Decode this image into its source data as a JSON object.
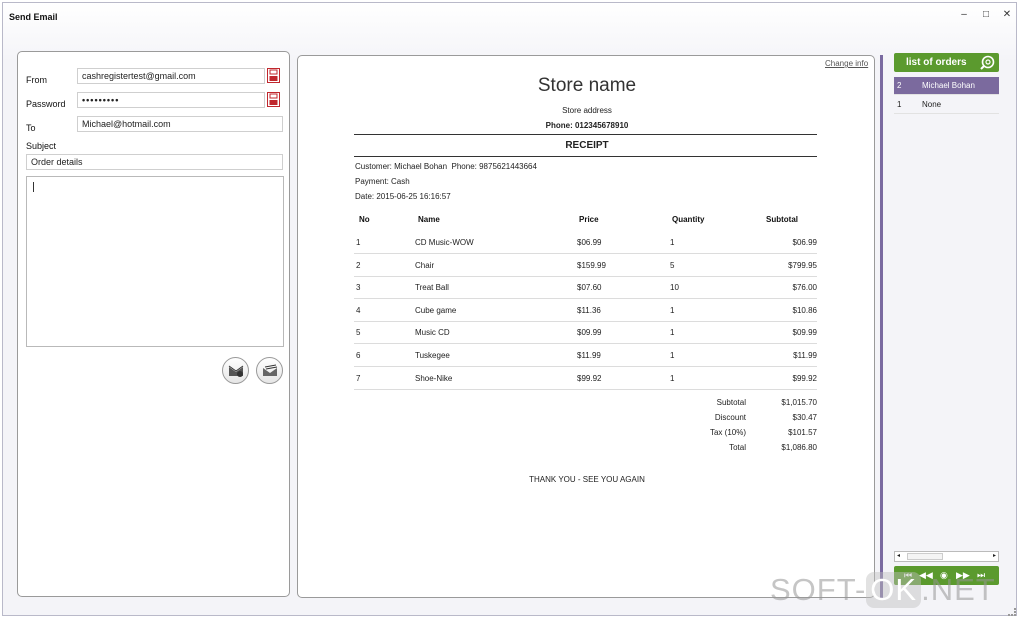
{
  "window": {
    "title": "Send Email",
    "minimize": "–",
    "maximize": "□",
    "close": "✕"
  },
  "email_form": {
    "from_label": "From",
    "from_value": "cashregistertest@gmail.com",
    "password_label": "Password",
    "password_value": "•••••••••",
    "to_label": "To",
    "to_value": "Michael@hotmail.com",
    "subject_label": "Subject",
    "subject_value": "Order details",
    "body_value": ""
  },
  "receipt": {
    "change_info": "Change info",
    "store_name": "Store name",
    "store_address": "Store address",
    "phone": "Phone: 012345678910",
    "title": "RECEIPT",
    "customer_label": "Customer:",
    "customer_value": "Michael Bohan",
    "customer_phone_label": "Phone:",
    "customer_phone_value": "9875621443664",
    "payment_label": "Payment:",
    "payment_value": "Cash",
    "date_label": "Date:",
    "date_value": "2015-06-25 16:16:57",
    "columns": [
      "No",
      "Name",
      "Price",
      "Quantity",
      "Subtotal"
    ],
    "items": [
      {
        "no": "1",
        "name": "CD Music-WOW",
        "price": "$06.99",
        "qty": "1",
        "subtotal": "$06.99"
      },
      {
        "no": "2",
        "name": "Chair",
        "price": "$159.99",
        "qty": "5",
        "subtotal": "$799.95"
      },
      {
        "no": "3",
        "name": "Treat Ball",
        "price": "$07.60",
        "qty": "10",
        "subtotal": "$76.00"
      },
      {
        "no": "4",
        "name": "Cube game",
        "price": "$11.36",
        "qty": "1",
        "subtotal": "$10.86"
      },
      {
        "no": "5",
        "name": "Music CD",
        "price": "$09.99",
        "qty": "1",
        "subtotal": "$09.99"
      },
      {
        "no": "6",
        "name": "Tuskegee",
        "price": "$11.99",
        "qty": "1",
        "subtotal": "$11.99"
      },
      {
        "no": "7",
        "name": "Shoe-Nike",
        "price": "$99.92",
        "qty": "1",
        "subtotal": "$99.92"
      }
    ],
    "totals": [
      {
        "label": "Subtotal",
        "value": "$1,015.70"
      },
      {
        "label": "Discount",
        "value": "$30.47"
      },
      {
        "label": "Tax (10%)",
        "value": "$101.57"
      },
      {
        "label": "Total",
        "value": "$1,086.80"
      }
    ],
    "footer": "THANK YOU - SEE YOU AGAIN"
  },
  "orders": {
    "header": "list of orders",
    "list": [
      {
        "no": "2",
        "name": "Michael Bohan",
        "selected": true
      },
      {
        "no": "1",
        "name": "None",
        "selected": false
      }
    ],
    "nav": {
      "first": "⏮",
      "prev": "◀◀",
      "current": "◉",
      "next": "▶▶",
      "last": "⏭"
    }
  },
  "watermark": {
    "left": "SOFT-",
    "middle": "OK",
    "right": ".NET"
  },
  "colors": {
    "accent_green": "#5b9a2e",
    "accent_purple": "#7b6a9e",
    "save_red": "#c0272d"
  }
}
